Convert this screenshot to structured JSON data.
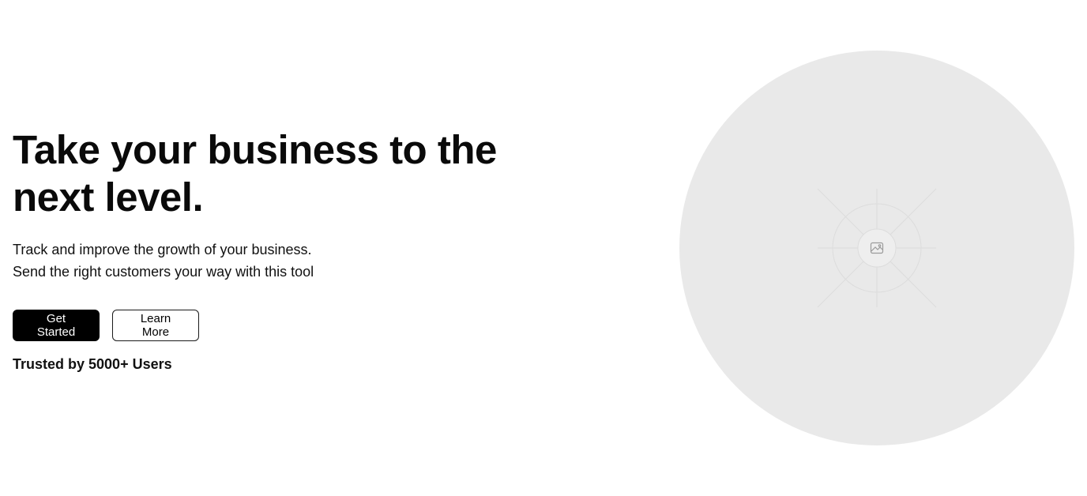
{
  "hero": {
    "headline": "Take your business to the next level.",
    "subtext_line1": "Track and improve the growth of your business.",
    "subtext_line2": "Send the right customers your way with this tool",
    "primary_button": "Get Started",
    "secondary_button": "Learn More",
    "trusted_text": "Trusted by 5000+ Users"
  },
  "visual": {
    "placeholder_icon": "image-icon",
    "background_color": "#e9e9e9"
  }
}
